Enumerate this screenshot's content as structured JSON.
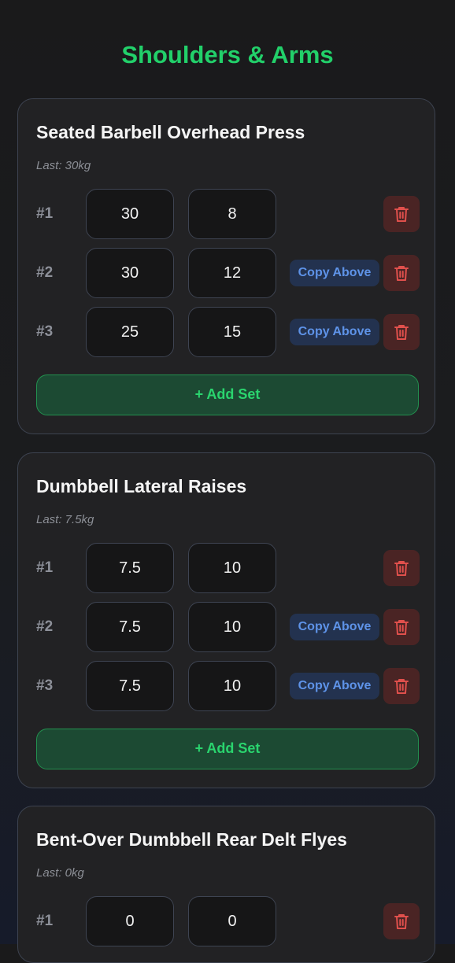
{
  "page": {
    "title": "Shoulders & Arms"
  },
  "labels": {
    "copy_above": "Copy Above",
    "add_set": "+ Add Set"
  },
  "exercises": [
    {
      "name": "Seated Barbell Overhead Press",
      "last": "Last: 30kg",
      "sets": [
        {
          "num": "#1",
          "weight": "30",
          "reps": "8"
        },
        {
          "num": "#2",
          "weight": "30",
          "reps": "12"
        },
        {
          "num": "#3",
          "weight": "25",
          "reps": "15"
        }
      ]
    },
    {
      "name": "Dumbbell Lateral Raises",
      "last": "Last: 7.5kg",
      "sets": [
        {
          "num": "#1",
          "weight": "7.5",
          "reps": "10"
        },
        {
          "num": "#2",
          "weight": "7.5",
          "reps": "10"
        },
        {
          "num": "#3",
          "weight": "7.5",
          "reps": "10"
        }
      ]
    },
    {
      "name": "Bent-Over Dumbbell Rear Delt Flyes",
      "last": "Last: 0kg",
      "sets": [
        {
          "num": "#1",
          "weight": "0",
          "reps": "0"
        }
      ]
    }
  ],
  "colors": {
    "accent_green": "#22d06a",
    "copy_blue": "#5e93e8",
    "delete_red": "#e0504c"
  },
  "icons": {
    "delete": "trash-icon"
  }
}
